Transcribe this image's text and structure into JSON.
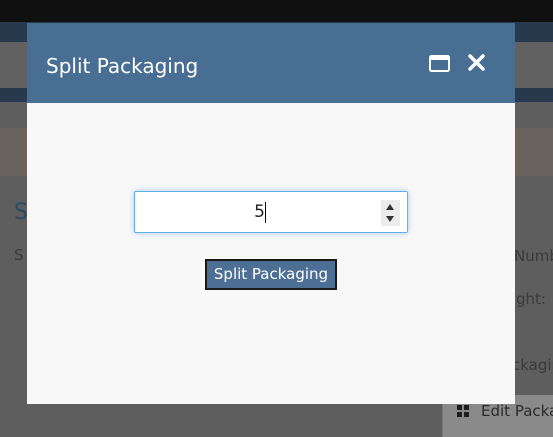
{
  "background": {
    "heading": "S",
    "subtext": "S",
    "right_label_1": "Numb",
    "right_label_2": "ght:",
    "right_label_3": "ckagin",
    "edit_button_label": "Edit Packa",
    "edit_button_icon": "grid-icon"
  },
  "modal": {
    "title": "Split Packaging",
    "header_color": "#496e93",
    "maximize_icon": "maximize-icon",
    "close_icon": "close-icon",
    "quantity": {
      "value": "5"
    },
    "submit_label": "Split Packaging",
    "submit_color": "#4d6f93"
  }
}
